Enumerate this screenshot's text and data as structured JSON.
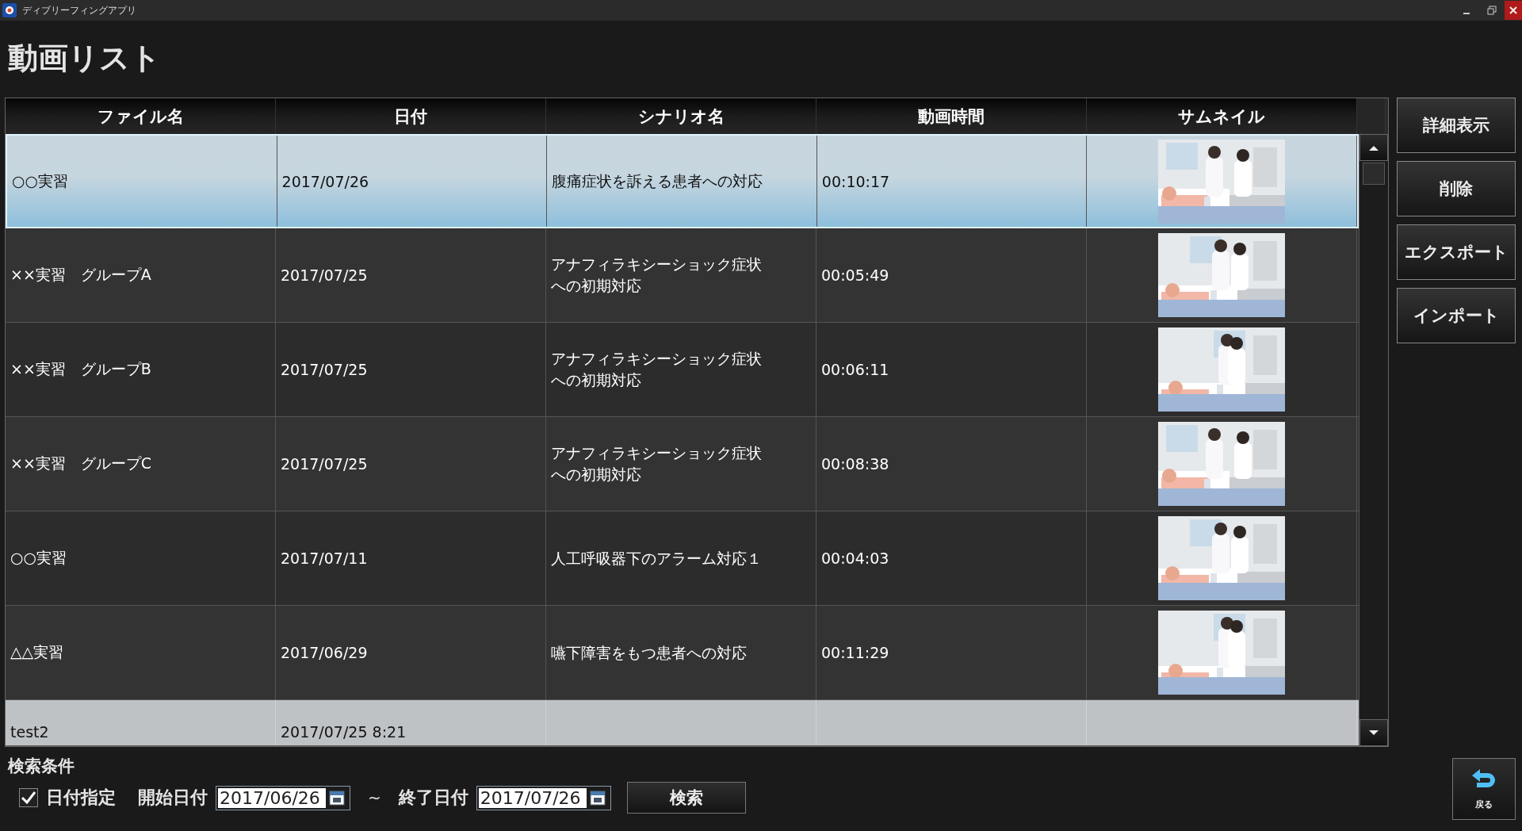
{
  "window": {
    "title": "ディブリーフィングアプリ"
  },
  "heading": "動画リスト",
  "table": {
    "columns": [
      "ファイル名",
      "日付",
      "シナリオ名",
      "動画時間",
      "サムネイル"
    ],
    "rows": [
      {
        "file": "○○実習",
        "date": "2017/07/26",
        "scenario": "腹痛症状を訴える患者への対応",
        "duration": "00:10:17",
        "selected": true,
        "hovered": false
      },
      {
        "file": "××実習　グループA",
        "date": "2017/07/25",
        "scenario": "アナフィラキシーショック症状への初期対応",
        "duration": "00:05:49",
        "selected": false,
        "hovered": false
      },
      {
        "file": "××実習　グループB",
        "date": "2017/07/25",
        "scenario": "アナフィラキシーショック症状への初期対応",
        "duration": "00:06:11",
        "selected": false,
        "hovered": false
      },
      {
        "file": "××実習　グループC",
        "date": "2017/07/25",
        "scenario": "アナフィラキシーショック症状への初期対応",
        "duration": "00:08:38",
        "selected": false,
        "hovered": false
      },
      {
        "file": "○○実習",
        "date": "2017/07/11",
        "scenario": "人工呼吸器下のアラーム対応１",
        "duration": "00:04:03",
        "selected": false,
        "hovered": false
      },
      {
        "file": "△△実習",
        "date": "2017/06/29",
        "scenario": "嚥下障害をもつ患者への対応",
        "duration": "00:11:29",
        "selected": false,
        "hovered": false
      },
      {
        "file": "test2",
        "date": "2017/07/25 8:21",
        "selected": false,
        "hovered": true
      }
    ]
  },
  "actions": [
    "詳細表示",
    "削除",
    "エクスポート",
    "インポート"
  ],
  "search": {
    "title": "検索条件",
    "date_filter": {
      "label": "日付指定",
      "checked": true
    },
    "start_label": "開始日付",
    "start_value": "2017/06/26",
    "separator": "~",
    "end_label": "終了日付",
    "end_value": "2017/07/26",
    "button": "検索"
  },
  "back_button": "戻る"
}
